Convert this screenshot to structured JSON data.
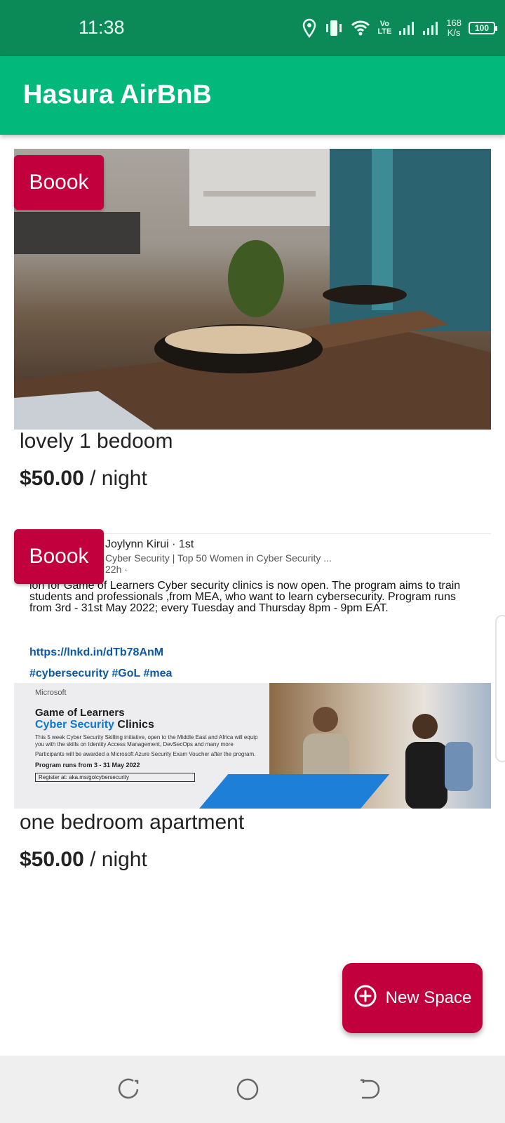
{
  "status_bar": {
    "time": "11:38",
    "volte": "Vo\nLTE",
    "speed_value": "168",
    "speed_unit": "K/s",
    "battery": "100"
  },
  "app_bar": {
    "title": "Hasura AirBnB"
  },
  "listings": [
    {
      "book_label": "Boook",
      "name": "lovely 1 bedoom",
      "price": "$50.00",
      "price_unit": " / night"
    },
    {
      "book_label": "Boook",
      "name": "one bedroom apartment",
      "price": "$50.00",
      "price_unit": " / night",
      "photo_text": {
        "author": "Joylynn Kirui · 1st",
        "subtitle": "Cyber Security | Top 50 Women in Cyber Security ...",
        "time": "22h ·",
        "body": "ion for Game of Learners Cyber security clinics is now open. The program aims to train students and professionals ,from MEA, who want to learn cybersecurity. Program runs from 3rd - 31st May 2022; every Tuesday and Thursday 8pm - 9pm EAT.",
        "link": "https://lnkd.in/dTb78AnM",
        "tags": "#cybersecurity #GoL #mea",
        "banner_logo": "Microsoft",
        "banner_title_1": "Game of Learners",
        "banner_title_2a": "Cyber Security",
        "banner_title_2b": " Clinics",
        "banner_desc": "This 5 week Cyber Security Skilling initiative, open to the Middle East and Africa will equip you with the skills on Identity Access Management, DevSecOps and many more",
        "banner_award": "Participants will be awarded a Microsoft Azure Security Exam Voucher after the program.",
        "banner_runs": "Program runs from 3 - 31 May 2022",
        "banner_register": "Register at: aka.ms/golcybersecurity"
      }
    }
  ],
  "fab": {
    "label": "New Space",
    "icon": "add-circle-icon"
  },
  "nav_bar": {
    "icons": [
      "recent-apps-icon",
      "home-icon",
      "back-icon"
    ]
  },
  "colors": {
    "status_bar": "#0b8a57",
    "app_bar": "#02b97b",
    "accent": "#c2003d"
  }
}
